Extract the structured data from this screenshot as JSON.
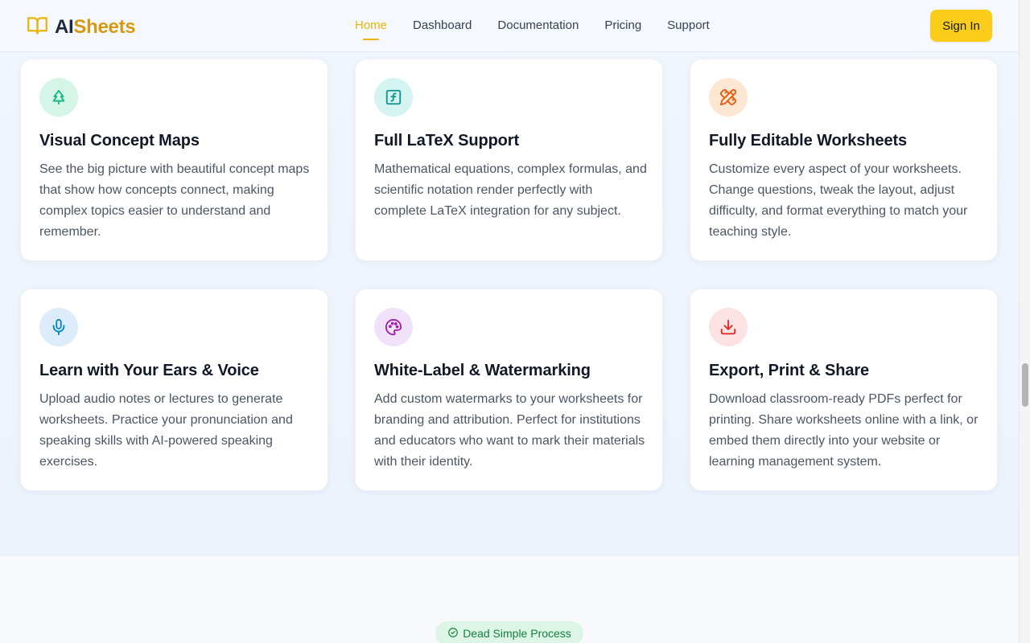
{
  "header": {
    "brand_ai": "AI",
    "brand_sheets": "Sheets",
    "logo_icon": "open-book-icon",
    "nav": [
      {
        "label": "Home",
        "active": true
      },
      {
        "label": "Dashboard",
        "active": false
      },
      {
        "label": "Documentation",
        "active": false
      },
      {
        "label": "Pricing",
        "active": false
      },
      {
        "label": "Support",
        "active": false
      }
    ],
    "signin_label": "Sign In"
  },
  "features": [
    {
      "icon": "tree-icon",
      "icon_color": "#10b981",
      "icon_bg": "#d5f5e8",
      "title": "Visual Concept Maps",
      "description": "See the big picture with beautiful concept maps that show how concepts connect, making complex topics easier to understand and remember."
    },
    {
      "icon": "function-square-icon",
      "icon_color": "#0f9488",
      "icon_bg": "#d3f4f1",
      "title": "Full LaTeX Support",
      "description": "Mathematical equations, complex formulas, and scientific notation render perfectly with complete LaTeX integration for any subject."
    },
    {
      "icon": "pencil-ruler-icon",
      "icon_color": "#ea580c",
      "icon_bg": "#fde7d2",
      "title": "Fully Editable Worksheets",
      "description": "Customize every aspect of your worksheets. Change questions, tweak the layout, adjust difficulty, and format everything to match your teaching style."
    },
    {
      "icon": "microphone-icon",
      "icon_color": "#0284c7",
      "icon_bg": "#dcecfb",
      "title": "Learn with Your Ears & Voice",
      "description": "Upload audio notes or lectures to generate worksheets. Practice your pronunciation and speaking skills with AI-powered speaking exercises."
    },
    {
      "icon": "palette-icon",
      "icon_color": "#a21caf",
      "icon_bg": "#f1e2fb",
      "title": "White-Label & Watermarking",
      "description": "Add custom watermarks to your worksheets for branding and attribution. Perfect for institutions and educators who want to mark their materials with their identity."
    },
    {
      "icon": "download-icon",
      "icon_color": "#dc2626",
      "icon_bg": "#fde2e4",
      "title": "Export, Print & Share",
      "description": "Download classroom-ready PDFs perfect for printing. Share worksheets online with a link, or embed them directly into your website or learning management system."
    }
  ],
  "process_badge": {
    "icon": "check-circle-icon",
    "label": "Dead Simple Process"
  },
  "colors": {
    "accent": "#eab308",
    "signin_bg": "#fbcd1a",
    "badge_bg": "#dcf5e7",
    "badge_text": "#15803d"
  }
}
